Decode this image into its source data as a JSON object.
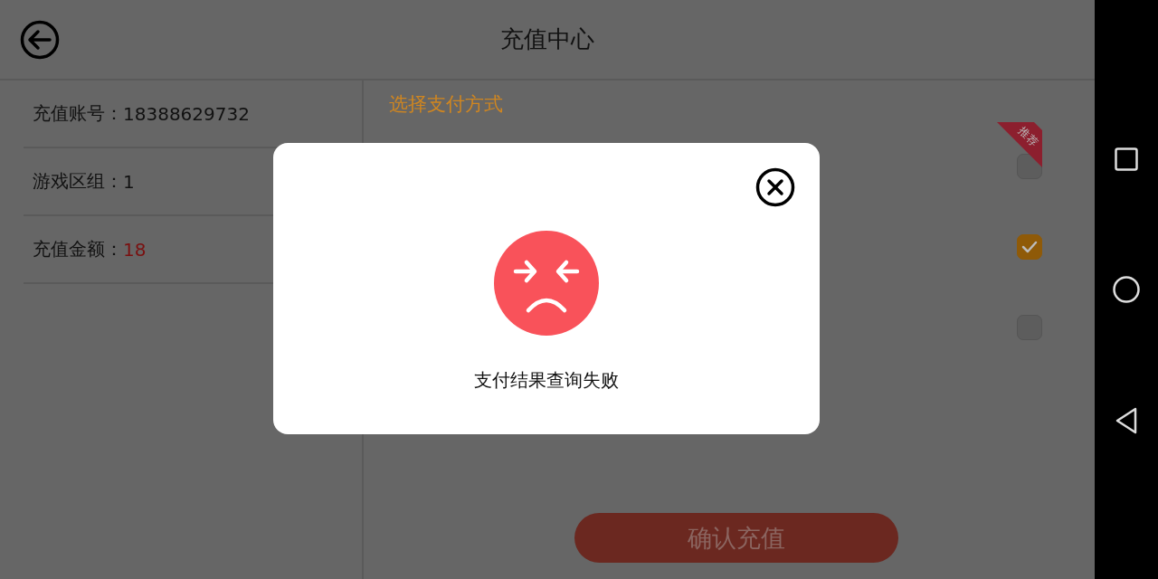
{
  "header": {
    "title": "充值中心"
  },
  "info_rows": [
    {
      "label": "充值账号：",
      "value": "18388629732",
      "kind": "plain"
    },
    {
      "label": "游戏区组：",
      "value": "1",
      "kind": "plain"
    },
    {
      "label": "充值金额：",
      "value": "18",
      "kind": "amount"
    }
  ],
  "payment": {
    "title": "选择支付方式",
    "options": [
      {
        "checked": false,
        "badge": "推荐"
      },
      {
        "checked": true
      },
      {
        "checked": false
      }
    ]
  },
  "confirm_button": "确认充值",
  "dialog": {
    "message": "支付结果查询失败"
  }
}
